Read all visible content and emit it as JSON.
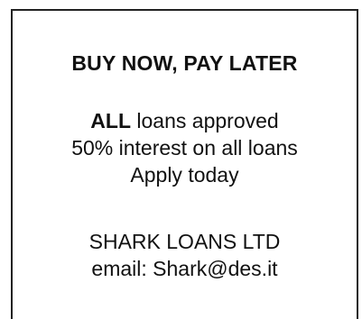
{
  "headline": "BUY NOW, PAY LATER",
  "offer": {
    "line1_bold": "ALL",
    "line1_rest": " loans approved",
    "line2": "50% interest on all loans",
    "line3": "Apply today"
  },
  "company": {
    "name": "SHARK LOANS LTD",
    "email": "email: Shark@des.it"
  }
}
